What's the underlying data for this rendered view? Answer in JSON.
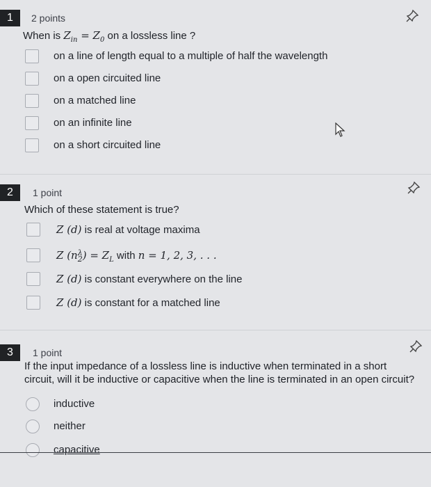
{
  "questions": [
    {
      "number": "1",
      "points": "2 points",
      "prompt_before": "When is ",
      "prompt_math": "Z_in = Z_0",
      "prompt_after": " on a lossless line ?",
      "type": "checkbox",
      "options": [
        "on a line of length equal to a multiple of half the wavelength",
        "on a open circuited line",
        "on a matched line",
        "on an infinite line",
        "on a short circuited line"
      ]
    },
    {
      "number": "2",
      "points": "1 point",
      "prompt": "Which of these statement is true?",
      "type": "checkbox",
      "options": [
        "Z (d) is real at voltage maxima",
        "Z (nλ/2) = Z_L with n = 1, 2, 3, . . .",
        "Z (d) is constant everywhere on the line",
        "Z (d) is constant for a matched line"
      ]
    },
    {
      "number": "3",
      "points": "1 point",
      "prompt_line1": "If the input impedance of a lossless line is inductive when terminated in a short",
      "prompt_line2": "circuit, will it be inductive or capacitive when the line is terminated in an open circuit?",
      "type": "radio",
      "options": [
        "inductive",
        "neither",
        "capacitive"
      ]
    }
  ],
  "icons": {
    "pin": "pin-icon",
    "cursor": "mouse-pointer-icon"
  }
}
